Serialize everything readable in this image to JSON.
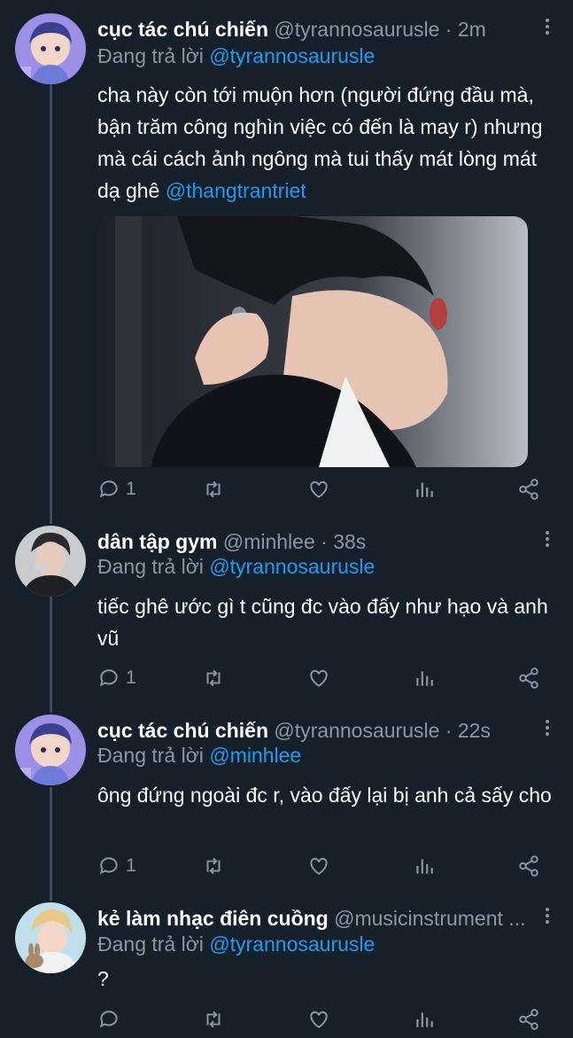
{
  "tweets": [
    {
      "name": "cục tác chú chiến",
      "handle": "@tyrannosaurusle",
      "time": "2m",
      "replying_prefix": "Đang trả lời ",
      "replying_to": "@tyrannosaurusle",
      "text": "cha này còn tới muộn hơn (người đứng đầu mà, bận trăm công nghìn việc có đến là may r) nhưng mà cái cách ảnh ngông mà tui thấy mát lòng mát dạ ghê ",
      "text_mention": "@thangtrantriet",
      "reply_count": "1",
      "avatar": "purple-anime-avatar"
    },
    {
      "name": "dân tập gym",
      "handle": "@minhlee",
      "time": "38s",
      "replying_prefix": "Đang trả lời ",
      "replying_to": "@tyrannosaurusle",
      "text": "tiếc ghê ước gì t cũng đc vào đấy như hạo và anh vũ",
      "reply_count": "1",
      "avatar": "dark-haired-person-avatar"
    },
    {
      "name": "cục tác chú chiến",
      "handle": "@tyrannosaurusle",
      "time": "22s",
      "replying_prefix": "Đang trả lời ",
      "replying_to": "@minhlee",
      "text": "ông đứng ngoài đc r, vào đấy lại bị anh cả sấy cho",
      "reply_count": "1",
      "avatar": "purple-anime-avatar"
    },
    {
      "name": "kẻ làm nhạc điên cuồng",
      "handle": "@musicinstrument ...",
      "time": "",
      "replying_prefix": "Đang trả lời ",
      "replying_to": "@tyrannosaurusle",
      "text": "?",
      "reply_count": "",
      "avatar": "blonde-person-with-bunny-avatar"
    }
  ],
  "separator": "·",
  "colors": {
    "background": "#15202b",
    "secondary_text": "#8899a6",
    "link": "#1d9bf0",
    "thread_line": "#3d4a57"
  },
  "icons": [
    "reply-icon",
    "retweet-icon",
    "like-icon",
    "analytics-icon",
    "share-icon",
    "more-icon"
  ]
}
